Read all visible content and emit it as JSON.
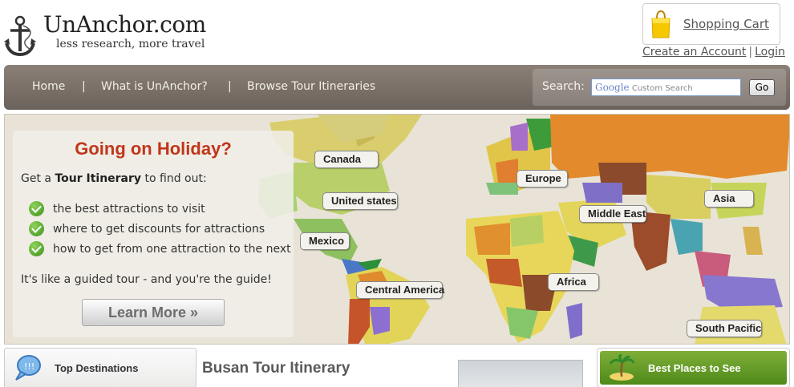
{
  "header": {
    "site_title": "UnAnchor.com",
    "tagline": "less research, more travel",
    "cart_label": "Shopping Cart",
    "create_account": "Create an Account",
    "account_sep": "|",
    "login": "Login"
  },
  "nav": {
    "items": [
      "Home",
      "What is UnAnchor?",
      "Browse Tour Itineraries"
    ],
    "separator": "|",
    "search_label": "Search:",
    "search_placeholder_brand": "Google",
    "search_placeholder_text": "Custom Search",
    "search_button": "Go"
  },
  "hero": {
    "title": "Going on Holiday?",
    "intro_prefix": "Get a",
    "intro_bold": "Tour Itinerary",
    "intro_suffix": "to find out:",
    "benefits": [
      "the best attractions to visit",
      "where to get discounts for attractions",
      "how to get from one attraction to the next"
    ],
    "outro": "It's like a guided tour - and you're the guide!",
    "cta": "Learn More »",
    "regions": [
      "Canada",
      "United states",
      "Mexico",
      "Central America",
      "Europe",
      "Middle East",
      "Asia",
      "Africa",
      "South Pacific"
    ]
  },
  "bottom": {
    "top_destinations": "Top Destinations",
    "page_title": "Busan Tour Itinerary",
    "best_places": "Best Places to See"
  },
  "colors": {
    "nav_bg": "#7a7068",
    "promo_title": "#c0361b",
    "best_places_bg": "#5f9a24"
  }
}
